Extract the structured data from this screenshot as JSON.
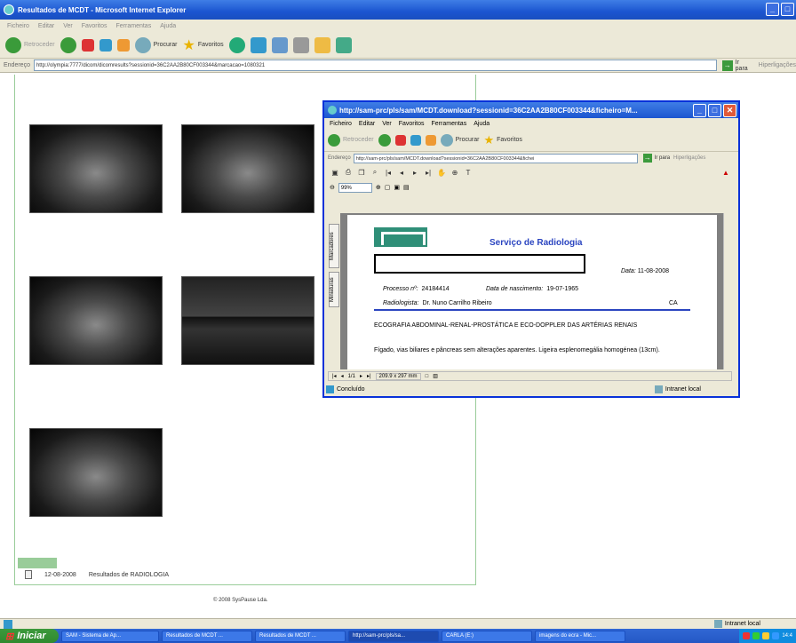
{
  "window": {
    "title": "Resultados de MCDT - Microsoft Internet Explorer",
    "menu": [
      "Ficheiro",
      "Editar",
      "Ver",
      "Favoritos",
      "Ferramentas",
      "Ajuda"
    ],
    "toolbar": {
      "back": "Retroceder",
      "search": "Procurar",
      "favorites": "Favoritos"
    },
    "address_label": "Endereço",
    "address": "http://olympia:7777/dicom/dicomresults?sessionid=36C2AA2B80CF003344&marcacao=1080321",
    "go_label": "Ir para",
    "links_label": "Hiperligações"
  },
  "results": {
    "date": "12-08-2008",
    "label": "Resultados de RADIOLOGIA",
    "copyright": "© 2008 SysPause Lda."
  },
  "popup": {
    "title": "http://sam-prc/pls/sam/MCDT.download?sessionid=36C2AA2B80CF003344&ficheiro=M...",
    "menu": [
      "Ficheiro",
      "Editar",
      "Ver",
      "Favoritos",
      "Ferramentas",
      "Ajuda"
    ],
    "toolbar": {
      "back": "Retroceder",
      "search": "Procurar",
      "favorites": "Favoritos"
    },
    "address_label": "Endereço",
    "address": "http://sam-prc/pls/sam/MCDT.download?sessionid=36C2AA2B80CF003344&fichei",
    "go_label": "Ir para",
    "links_label": "Hiperligações",
    "zoom": "99%",
    "side_tab_1": "Marcadores",
    "side_tab_2": "Miniaturas",
    "page_nav": "1/1",
    "page_size": "209.9 x 297 mm",
    "status": "Concluído",
    "zone": "Intranet local",
    "document": {
      "header": "Serviço de Radiologia",
      "date_label": "Data:",
      "date": "11-08-2008",
      "process_label": "Processo nº:",
      "process": "24184414",
      "birth_label": "Data de nascimento:",
      "birth": "19-07-1965",
      "radiologist_label": "Radiologista:",
      "radiologist": "Dr. Nuno Carrilho Ribeiro",
      "code": "CA",
      "exam": "ECOGRAFIA ABDOMINAL-RENAL-PROSTÁTICA E ECO-DOPPLER DAS ARTÉRIAS RENAIS",
      "finding": "Fígado, vias biliares e pâncreas sem alterações aparentes. Ligeira esplenomegália homogénea (13cm)."
    }
  },
  "statusbar": {
    "zone": "Intranet local"
  },
  "taskbar": {
    "start": "Iniciar",
    "tasks": [
      "SAM - Sistema de Ap...",
      "Resultados de MCDT ...",
      "Resultados de MCDT ...",
      "http://sam-prc/pls/sa...",
      "CARLA (E:)",
      "imagens do ecra - Mic..."
    ],
    "clock": "14:4"
  }
}
